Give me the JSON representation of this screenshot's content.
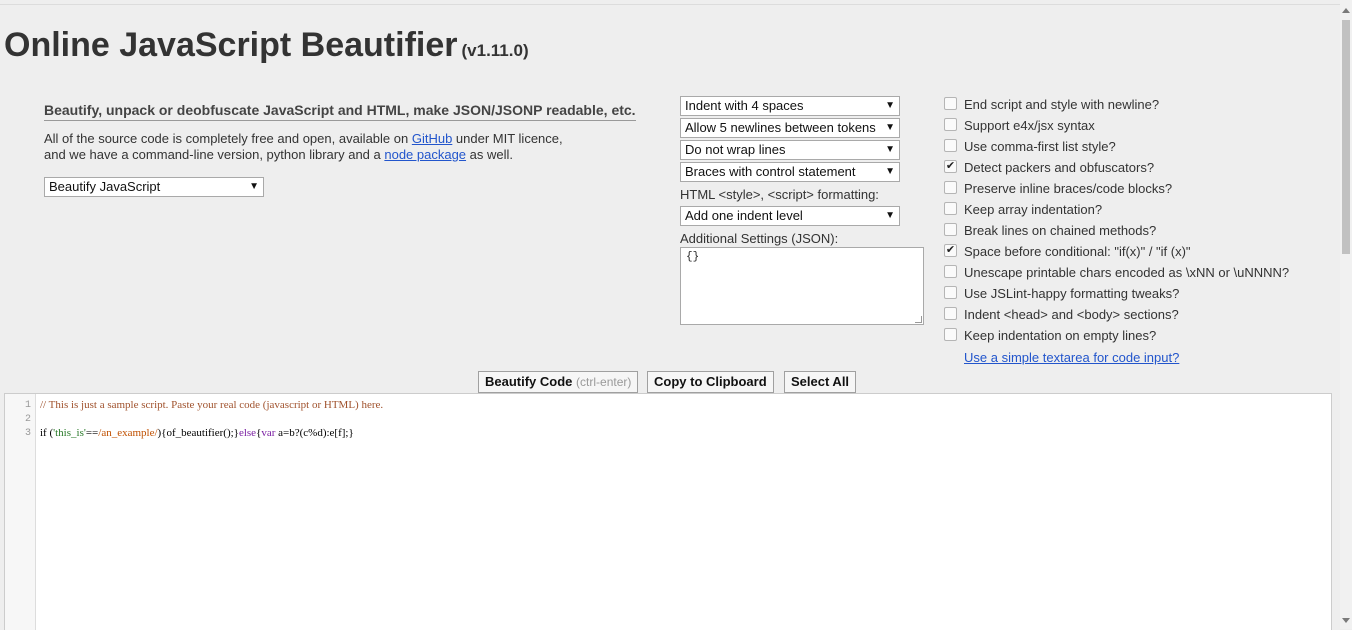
{
  "header": {
    "title": "Online JavaScript Beautifier",
    "version": "(v1.11.0)"
  },
  "intro": {
    "tagline": "Beautify, unpack or deobfuscate JavaScript and HTML, make JSON/JSONP readable, etc.",
    "line1_pre": "All of the source code is completely free and open, available on ",
    "line1_link": "GitHub",
    "line1_post": " under MIT licence,",
    "line2_pre": "and we have a command-line version, python library and a ",
    "line2_link": "node package",
    "line2_post": " as well."
  },
  "language_select": {
    "value": "Beautify JavaScript"
  },
  "settings": {
    "indent": "Indent with 4 spaces",
    "newlines": "Allow 5 newlines between tokens",
    "wrap": "Do not wrap lines",
    "braces": "Braces with control statement",
    "html_label": "HTML <style>, <script> formatting:",
    "html_value": "Add one indent level",
    "additional_label": "Additional Settings (JSON):",
    "additional_value": "{}"
  },
  "options": [
    {
      "label": "End script and style with newline?",
      "checked": false
    },
    {
      "label": "Support e4x/jsx syntax",
      "checked": false
    },
    {
      "label": "Use comma-first list style?",
      "checked": false
    },
    {
      "label": "Detect packers and obfuscators?",
      "checked": true
    },
    {
      "label": "Preserve inline braces/code blocks?",
      "checked": false
    },
    {
      "label": "Keep array indentation?",
      "checked": false
    },
    {
      "label": "Break lines on chained methods?",
      "checked": false
    },
    {
      "label": "Space before conditional: \"if(x)\" / \"if (x)\"",
      "checked": true
    },
    {
      "label": "Unescape printable chars encoded as \\xNN or \\uNNNN?",
      "checked": false
    },
    {
      "label": "Use JSLint-happy formatting tweaks?",
      "checked": false
    },
    {
      "label": "Indent <head> and <body> sections?",
      "checked": false
    },
    {
      "label": "Keep indentation on empty lines?",
      "checked": false
    }
  ],
  "textarea_link": "Use a simple textarea for code input?",
  "buttons": {
    "beautify": "Beautify Code",
    "beautify_hint": "(ctrl-enter)",
    "copy": "Copy to Clipboard",
    "select_all": "Select All"
  },
  "editor": {
    "line_numbers": [
      "1",
      "2",
      "3"
    ],
    "line1": "// This is just a sample script. Paste your real code (javascript or HTML) here.",
    "l3_a": "if (",
    "l3_str": "'this_is'",
    "l3_b": "==",
    "l3_re": "/an_example/",
    "l3_c": "){of_beautifier();}",
    "l3_kw1": "else",
    "l3_d": "{",
    "l3_kw2": "var",
    "l3_e": " a=b?(c%d):e[f];}"
  }
}
